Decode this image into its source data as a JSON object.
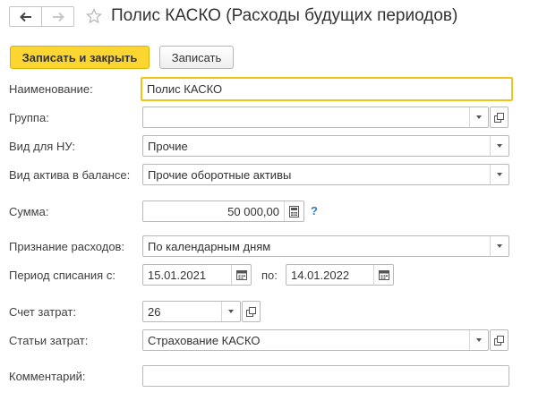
{
  "header": {
    "back_icon": "arrow-left-icon",
    "forward_icon": "arrow-right-icon",
    "favorite_icon": "star-outline-icon",
    "title": "Полис КАСКО (Расходы будущих периодов)"
  },
  "toolbar": {
    "save_close_label": "Записать и закрыть",
    "save_label": "Записать"
  },
  "form": {
    "name": {
      "label": "Наименование:",
      "value": "Полис КАСКО"
    },
    "group": {
      "label": "Группа:",
      "value": ""
    },
    "nu_type": {
      "label": "Вид для НУ:",
      "value": "Прочие"
    },
    "asset_type": {
      "label": "Вид актива в балансе:",
      "value": "Прочие оборотные активы"
    },
    "amount": {
      "label": "Сумма:",
      "value": "50 000,00",
      "help": "?"
    },
    "recognition": {
      "label": "Признание расходов:",
      "value": "По календарным дням"
    },
    "period": {
      "label": "Период списания с:",
      "from": "15.01.2021",
      "to_label": "по:",
      "to": "14.01.2022"
    },
    "cost_account": {
      "label": "Счет затрат:",
      "value": "26"
    },
    "cost_items": {
      "label": "Статьи затрат:",
      "value": "Страхование КАСКО"
    },
    "comment": {
      "label": "Комментарий:",
      "value": ""
    }
  },
  "colors": {
    "primary_button": "#fbd630",
    "focus_border": "#f2c419",
    "help_link": "#2f7ac0"
  }
}
